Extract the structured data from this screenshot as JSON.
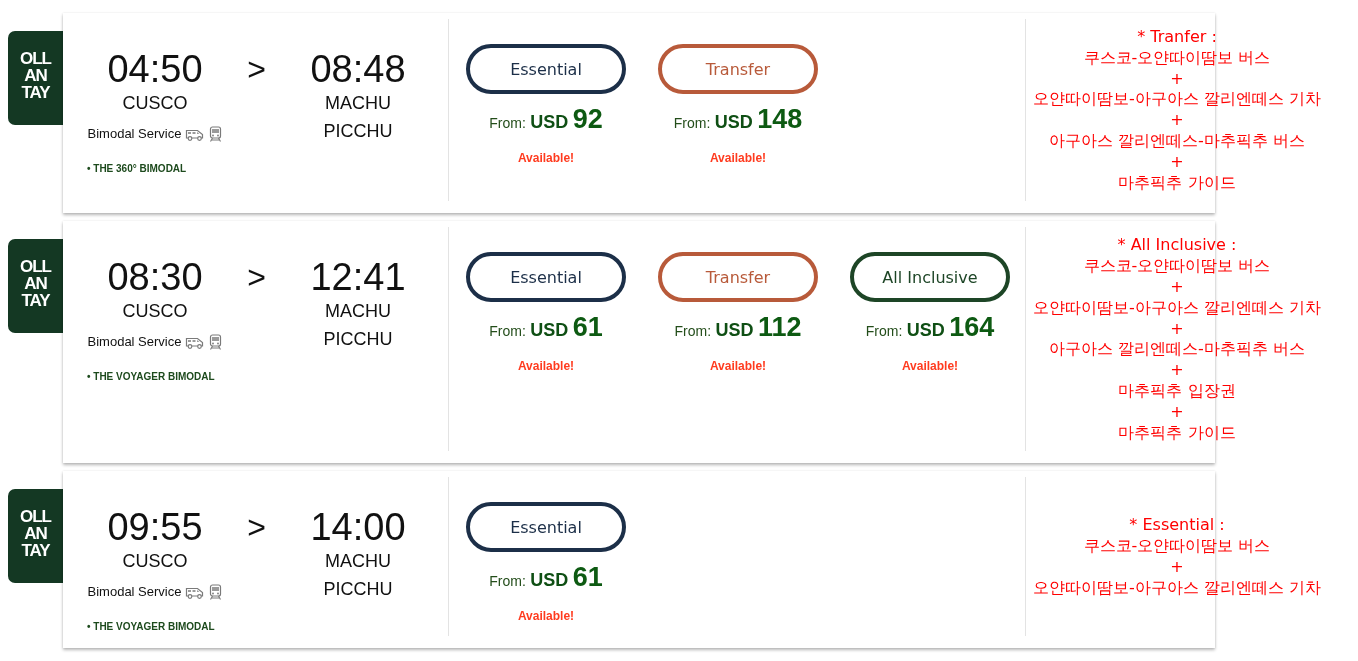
{
  "trips": [
    {
      "logo": [
        "OLL",
        "AN",
        "TAY"
      ],
      "departure": {
        "time": "04:50",
        "city": "CUSCO"
      },
      "separator": ">",
      "arrival": {
        "time": "08:48",
        "city": "MACHU PICCHU"
      },
      "service": "Bimodal Service",
      "route": "• THE 360° BIMODAL",
      "fares": [
        {
          "kind": "essential",
          "label": "Essential",
          "from": "From:",
          "currency": "USD",
          "amount": "92",
          "status": "Available!"
        },
        {
          "kind": "transfer",
          "label": "Transfer",
          "from": "From:",
          "currency": "USD",
          "amount": "148",
          "status": "Available!"
        }
      ],
      "note": {
        "title": "* Tranfer :",
        "lines": [
          "쿠스코-오얀따이땀보 버스",
          "+",
          "오얀따이땀보-아구아스 깔리엔떼스 기차",
          "+",
          "아구아스 깔리엔떼스-마추픽추 버스",
          "+",
          "마추픽추 가이드"
        ]
      }
    },
    {
      "logo": [
        "OLL",
        "AN",
        "TAY"
      ],
      "departure": {
        "time": "08:30",
        "city": "CUSCO"
      },
      "separator": ">",
      "arrival": {
        "time": "12:41",
        "city": "MACHU PICCHU"
      },
      "service": "Bimodal Service",
      "route": "• THE VOYAGER BIMODAL",
      "fares": [
        {
          "kind": "essential",
          "label": "Essential",
          "from": "From:",
          "currency": "USD",
          "amount": "61",
          "status": "Available!"
        },
        {
          "kind": "transfer",
          "label": "Transfer",
          "from": "From:",
          "currency": "USD",
          "amount": "112",
          "status": "Available!"
        },
        {
          "kind": "all_inclusive",
          "label": "All Inclusive",
          "from": "From:",
          "currency": "USD",
          "amount": "164",
          "status": "Available!"
        }
      ],
      "note": {
        "title": "* All Inclusive :",
        "lines": [
          "쿠스코-오얀따이땀보 버스",
          "+",
          "오얀따이땀보-아구아스 깔리엔떼스 기차",
          "+",
          "아구아스 깔리엔떼스-마추픽추 버스",
          "+",
          "마추픽추 입장권",
          "+",
          "마추픽추 가이드"
        ]
      }
    },
    {
      "logo": [
        "OLL",
        "AN",
        "TAY"
      ],
      "departure": {
        "time": "09:55",
        "city": "CUSCO"
      },
      "separator": ">",
      "arrival": {
        "time": "14:00",
        "city": "MACHU PICCHU"
      },
      "service": "Bimodal Service",
      "route": "• THE VOYAGER BIMODAL",
      "fares": [
        {
          "kind": "essential",
          "label": "Essential",
          "from": "From:",
          "currency": "USD",
          "amount": "61",
          "status": "Available!"
        }
      ],
      "note": {
        "title": "* Essential :",
        "lines": [
          "쿠스코-오얀따이땀보 버스",
          "+",
          "오얀따이땀보-아구아스 깔리엔떼스 기차"
        ]
      }
    }
  ]
}
